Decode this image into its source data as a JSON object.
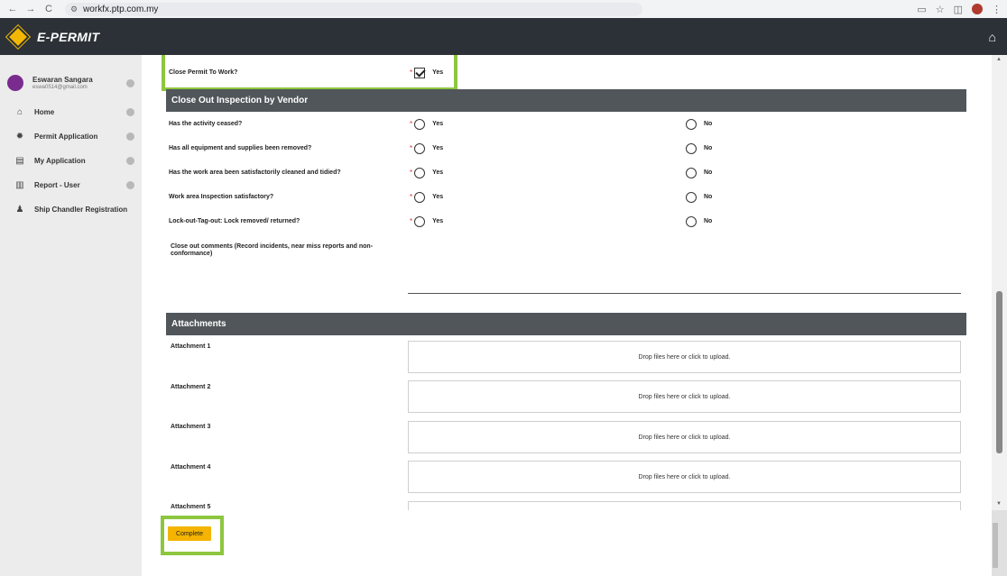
{
  "browser": {
    "back": "←",
    "forward": "→",
    "reload": "C",
    "url": "workfx.ptp.com.my"
  },
  "app": {
    "title": "E-PERMIT",
    "home_icon": "home-icon"
  },
  "sidebar": {
    "user_name": "Eswaran Sangara",
    "user_email": "eswa0514@gmail.com",
    "items": [
      {
        "label": "Home",
        "icon": "home-icon"
      },
      {
        "label": "Permit Application",
        "icon": "gear-icon"
      },
      {
        "label": "My Application",
        "icon": "document-icon"
      },
      {
        "label": "Report - User",
        "icon": "chart-icon"
      },
      {
        "label": "Ship Chandler Registration",
        "icon": "person-icon"
      }
    ]
  },
  "form": {
    "close_permit": {
      "label": "Close Permit To Work?",
      "value": "Yes",
      "checked": true
    },
    "close_out_header": "Close Out Inspection by Vendor",
    "questions": [
      {
        "label": "Has the activity ceased?",
        "yes": "Yes",
        "no": "No"
      },
      {
        "label": "Has all equipment and supplies been removed?",
        "yes": "Yes",
        "no": "No"
      },
      {
        "label": "Has the work area been satisfactorily cleaned and tidied?",
        "yes": "Yes",
        "no": "No"
      },
      {
        "label": "Work area Inspection satisfactory?",
        "yes": "Yes",
        "no": "No"
      },
      {
        "label": "Lock-out-Tag-out: Lock removed/ returned?",
        "yes": "Yes",
        "no": "No"
      }
    ],
    "comments_label": "Close out comments (Record incidents, near miss reports and non-conformance)",
    "required_mark": "*",
    "attachments_header": "Attachments",
    "attachments": [
      {
        "label": "Attachment 1",
        "dropzone": "Drop files here or click to upload."
      },
      {
        "label": "Attachment 2",
        "dropzone": "Drop files here or click to upload."
      },
      {
        "label": "Attachment 3",
        "dropzone": "Drop files here or click to upload."
      },
      {
        "label": "Attachment 4",
        "dropzone": "Drop files here or click to upload."
      },
      {
        "label": "Attachment 5",
        "dropzone": ""
      }
    ],
    "complete_label": "Complete"
  },
  "colors": {
    "header_bg": "#2b3136",
    "section_bg": "#50565a",
    "highlight": "#8dc63f",
    "button": "#f4b400",
    "required": "#dd3333"
  }
}
